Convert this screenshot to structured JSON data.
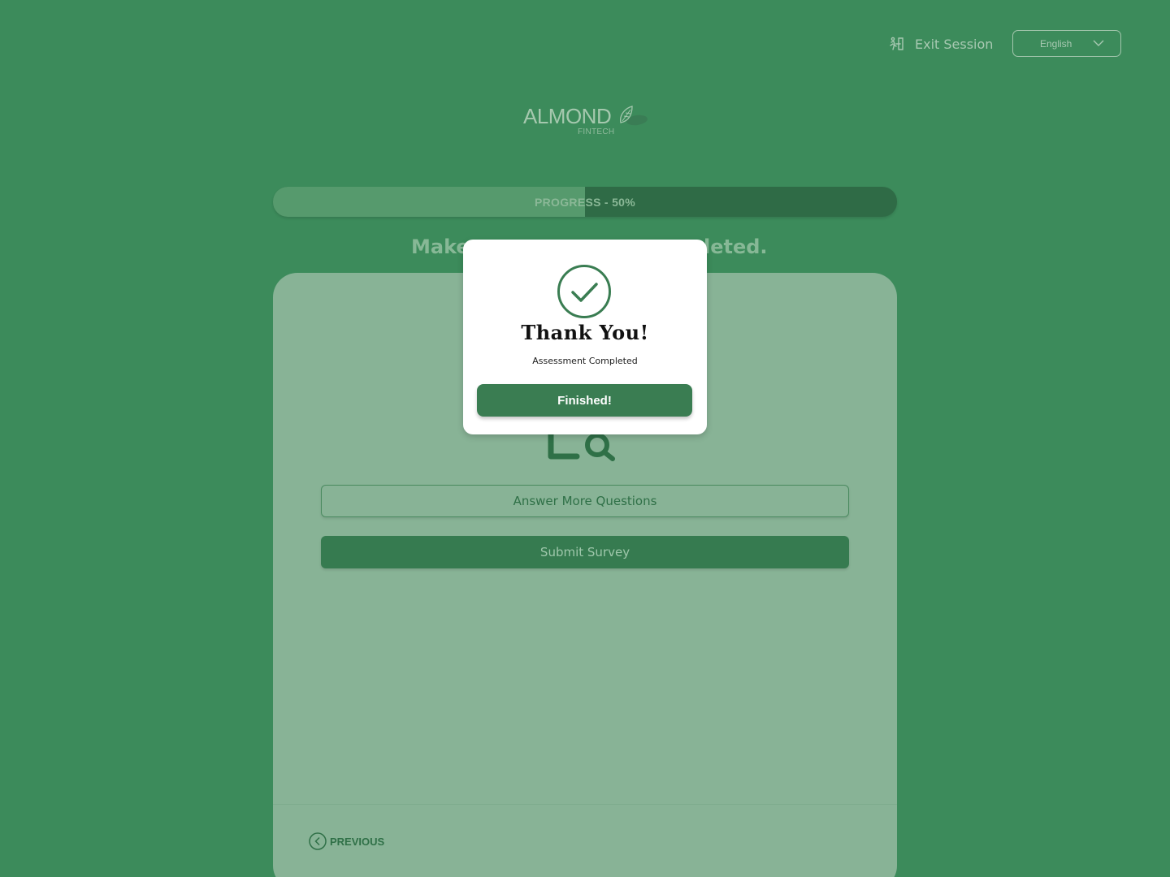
{
  "header": {
    "exit_label": "Exit Session",
    "exit_icon": "exit-person-icon",
    "language": {
      "selected": "English",
      "icon": "chevron-down-icon"
    }
  },
  "logo": {
    "word": "ALMOND",
    "sub": "FINTECH",
    "icon": "almond-leaf-icon"
  },
  "progress": {
    "label": "PROGRESS - 50%",
    "value": 0.5
  },
  "main": {
    "heading_left": "Make",
    "heading_right": "leted.",
    "illustration_icon": "document-search-icon",
    "answer_more_label": "Answer More Questions",
    "submit_label": "Submit Survey",
    "previous_label": "PREVIOUS",
    "previous_icon": "chevron-left-circle-icon"
  },
  "modal": {
    "icon": "check-circle-icon",
    "title": "Thank You!",
    "subtitle": "Assessment Completed",
    "button_label": "Finished!"
  },
  "colors": {
    "background": "#3c8b5b",
    "card": "#88b396",
    "accent": "#3a7d52",
    "modal": "#ffffff"
  }
}
